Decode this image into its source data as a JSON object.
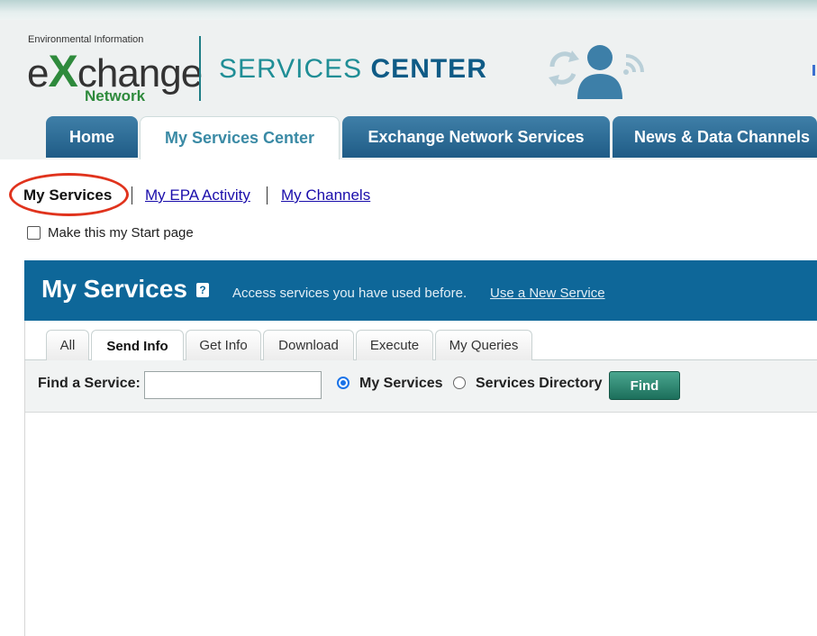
{
  "header": {
    "logo_small": "Environmental Information",
    "logo_pre": "e",
    "logo_x": "X",
    "logo_post": "change",
    "logo_network": "Network",
    "title_part1": "SERVICES ",
    "title_part2": "CENTER"
  },
  "nav": {
    "tabs": [
      {
        "label": "Home"
      },
      {
        "label": "My Services Center"
      },
      {
        "label": "Exchange Network Services"
      },
      {
        "label": "News & Data Channels"
      }
    ]
  },
  "subnav": {
    "current": "My Services",
    "link1": "My EPA Activity",
    "link2": "My Channels"
  },
  "startpage": {
    "label": "Make this my Start page"
  },
  "banner": {
    "title": "My Services",
    "help": "?",
    "subtitle": "Access services you have used before.",
    "link": "Use a New Service"
  },
  "service_tabs": [
    {
      "label": "All"
    },
    {
      "label": "Send Info"
    },
    {
      "label": "Get Info"
    },
    {
      "label": "Download"
    },
    {
      "label": "Execute"
    },
    {
      "label": "My Queries"
    }
  ],
  "find": {
    "label": "Find a Service:",
    "value": "",
    "radio1": "My Services",
    "radio2": "Services Directory",
    "button": "Find"
  }
}
